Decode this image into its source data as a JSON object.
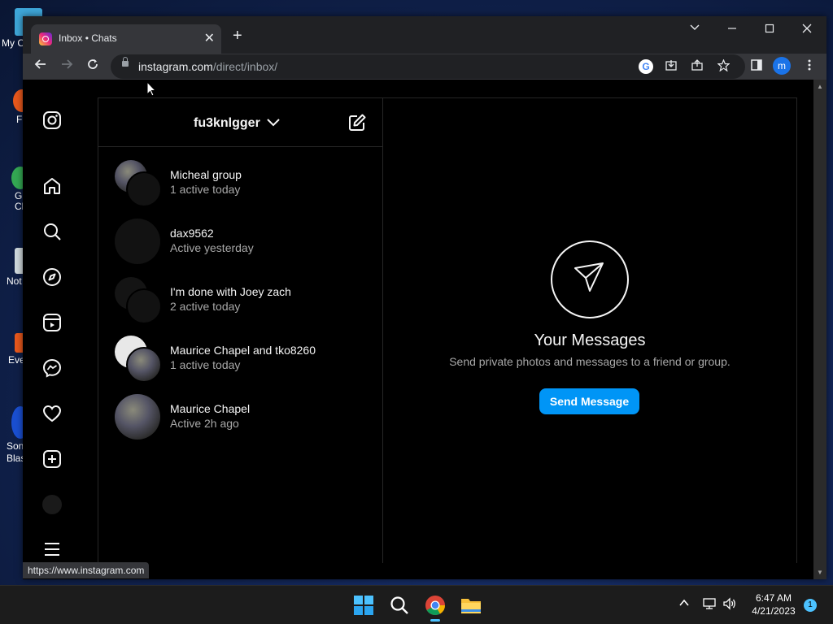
{
  "desktop": {
    "icons": [
      {
        "label": "My C",
        "color": "#3ea6d8"
      },
      {
        "label": "F",
        "color": "#e8581c"
      },
      {
        "label": "G\nCh",
        "color": "#34a853"
      },
      {
        "label": "Not",
        "color": "#cfd8dc"
      },
      {
        "label": "Eve",
        "color": "#e8581c"
      },
      {
        "label": "Son\nBlas",
        "color": "#1a4fd1"
      }
    ]
  },
  "browser": {
    "tab_title": "Inbox • Chats",
    "tab_close": "✕",
    "new_tab": "+",
    "url_host": "instagram.com",
    "url_path": "/direct/inbox/",
    "profile_initial": "m",
    "status_url": "https://www.instagram.com"
  },
  "sidebar": {
    "items": [
      "instagram-logo",
      "home",
      "search",
      "explore",
      "reels",
      "messages",
      "notifications",
      "create",
      "profile",
      "more"
    ]
  },
  "inbox": {
    "username": "fu3knlgger",
    "threads": [
      {
        "name": "Micheal group",
        "status": "1 active today",
        "avatar": "group-photo"
      },
      {
        "name": "dax9562",
        "status": "Active yesterday",
        "avatar": "blank"
      },
      {
        "name": "I'm done with Joey zach",
        "status": "2 active today",
        "avatar": "group-blank"
      },
      {
        "name": "Maurice Chapel and tko8260",
        "status": "1 active today",
        "avatar": "group-light"
      },
      {
        "name": "Maurice Chapel",
        "status": "Active 2h ago",
        "avatar": "photo"
      }
    ]
  },
  "empty_state": {
    "title": "Your Messages",
    "subtitle": "Send private photos and messages to a friend or group.",
    "button": "Send Message"
  },
  "taskbar": {
    "time": "6:47 AM",
    "date": "4/21/2023",
    "notification_count": "1"
  },
  "colors": {
    "accent": "#0095f6",
    "background": "#000000",
    "border": "#262626"
  }
}
